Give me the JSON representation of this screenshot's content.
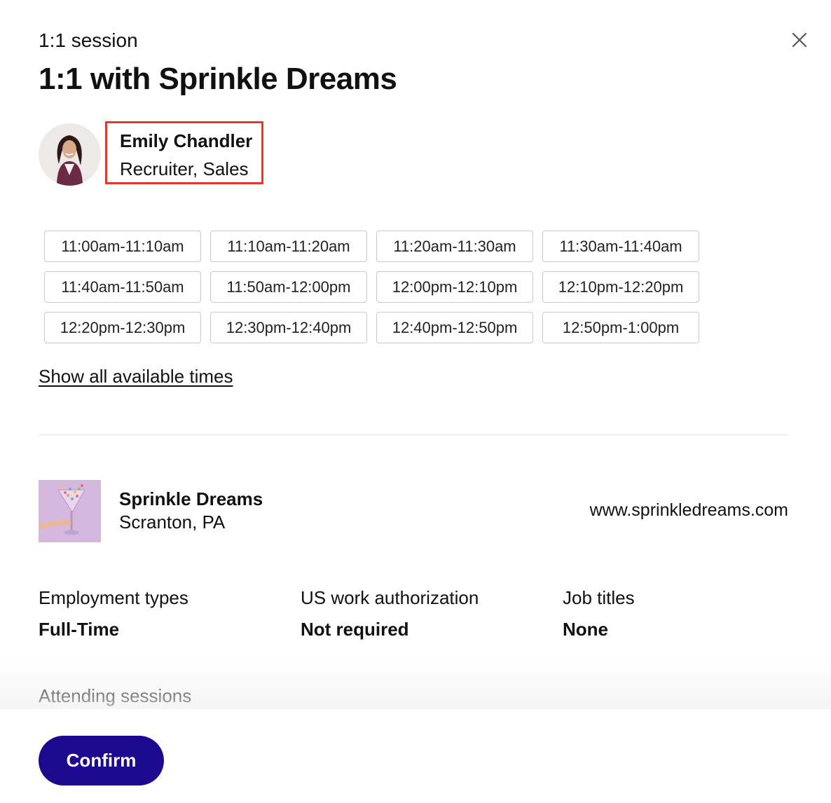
{
  "modal": {
    "eyebrow": "1:1 session",
    "title": "1:1 with Sprinkle Dreams"
  },
  "host": {
    "name": "Emily Chandler",
    "role": "Recruiter, Sales"
  },
  "time_slots": [
    "11:00am-11:10am",
    "11:10am-11:20am",
    "11:20am-11:30am",
    "11:30am-11:40am",
    "11:40am-11:50am",
    "11:50am-12:00pm",
    "12:00pm-12:10pm",
    "12:10pm-12:20pm",
    "12:20pm-12:30pm",
    "12:30pm-12:40pm",
    "12:40pm-12:50pm",
    "12:50pm-1:00pm"
  ],
  "show_all_label": "Show all available times",
  "company": {
    "name": "Sprinkle Dreams",
    "location": "Scranton, PA",
    "website": "www.sprinkledreams.com"
  },
  "details": [
    {
      "label": "Employment types",
      "value": "Full-Time"
    },
    {
      "label": "US work authorization",
      "value": "Not required"
    },
    {
      "label": "Job titles",
      "value": "None"
    }
  ],
  "attending_label": "Attending sessions",
  "footer": {
    "confirm_label": "Confirm"
  },
  "colors": {
    "primary": "#1d0890",
    "highlight_border": "#e03a2f",
    "slot_border": "#c9c9c9",
    "logo_bg": "#d6b8df"
  }
}
